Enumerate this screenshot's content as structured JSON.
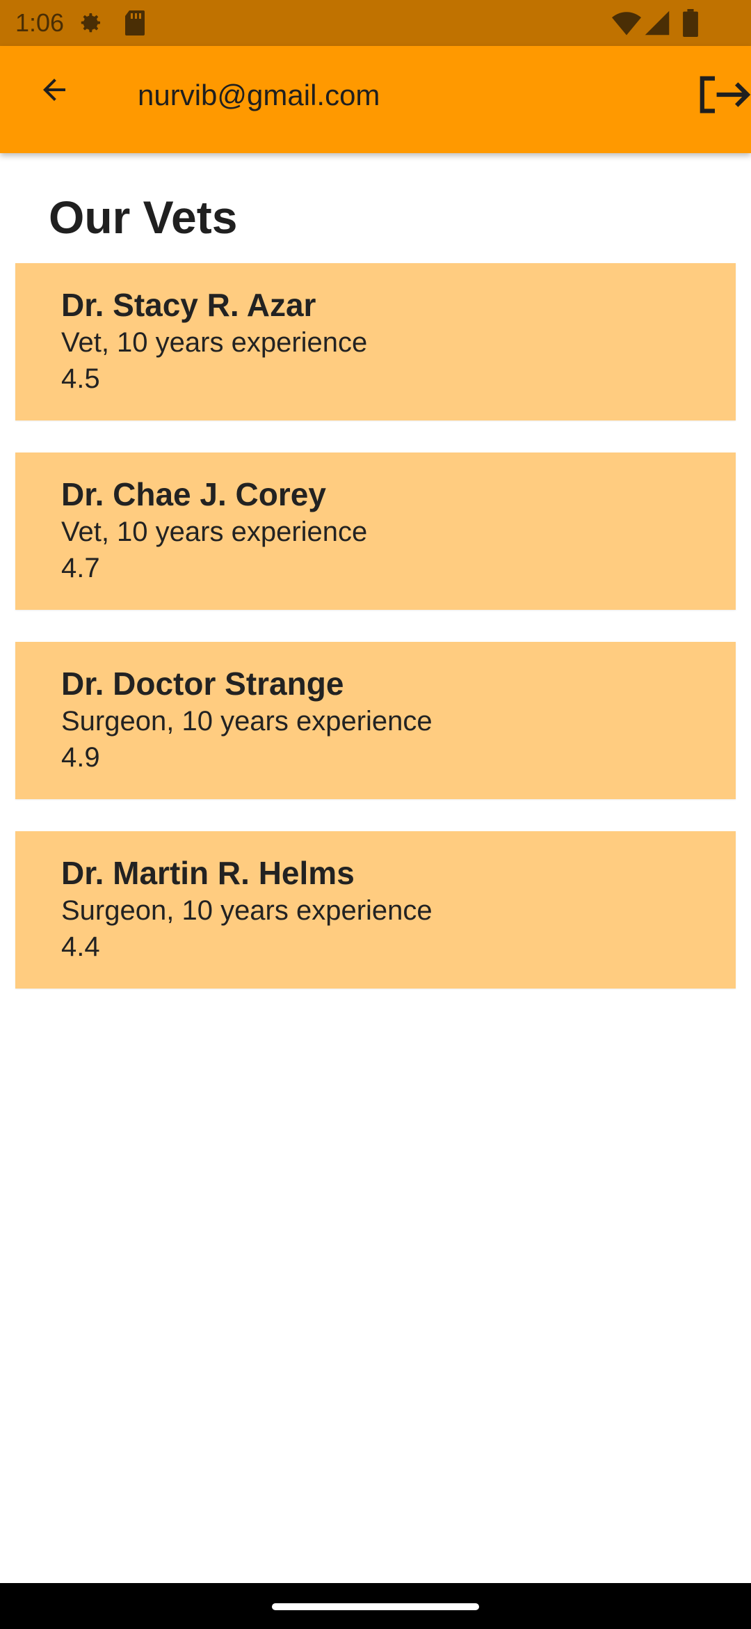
{
  "status_bar": {
    "time": "1:06",
    "icons": [
      "settings-gear-icon",
      "sd-card-icon",
      "wifi-icon",
      "cellular-signal-icon",
      "battery-icon"
    ]
  },
  "app_bar": {
    "title": "nurvib@gmail.com",
    "back_icon": "arrow-back-icon",
    "logout_icon": "logout-icon",
    "color": "#FF9900"
  },
  "page": {
    "title": "Our Vets"
  },
  "vets": [
    {
      "name": "Dr. Stacy R. Azar",
      "description": "Vet, 10 years experience",
      "rating": "4.5"
    },
    {
      "name": "Dr. Chae J. Corey",
      "description": "Vet, 10 years experience",
      "rating": "4.7"
    },
    {
      "name": "Dr. Doctor Strange",
      "description": "Surgeon, 10 years experience",
      "rating": "4.9"
    },
    {
      "name": "Dr. Martin R. Helms",
      "description": "Surgeon, 10 years experience",
      "rating": "4.4"
    }
  ],
  "colors": {
    "status_bar": "#C07200",
    "card": "#FFCC80"
  }
}
